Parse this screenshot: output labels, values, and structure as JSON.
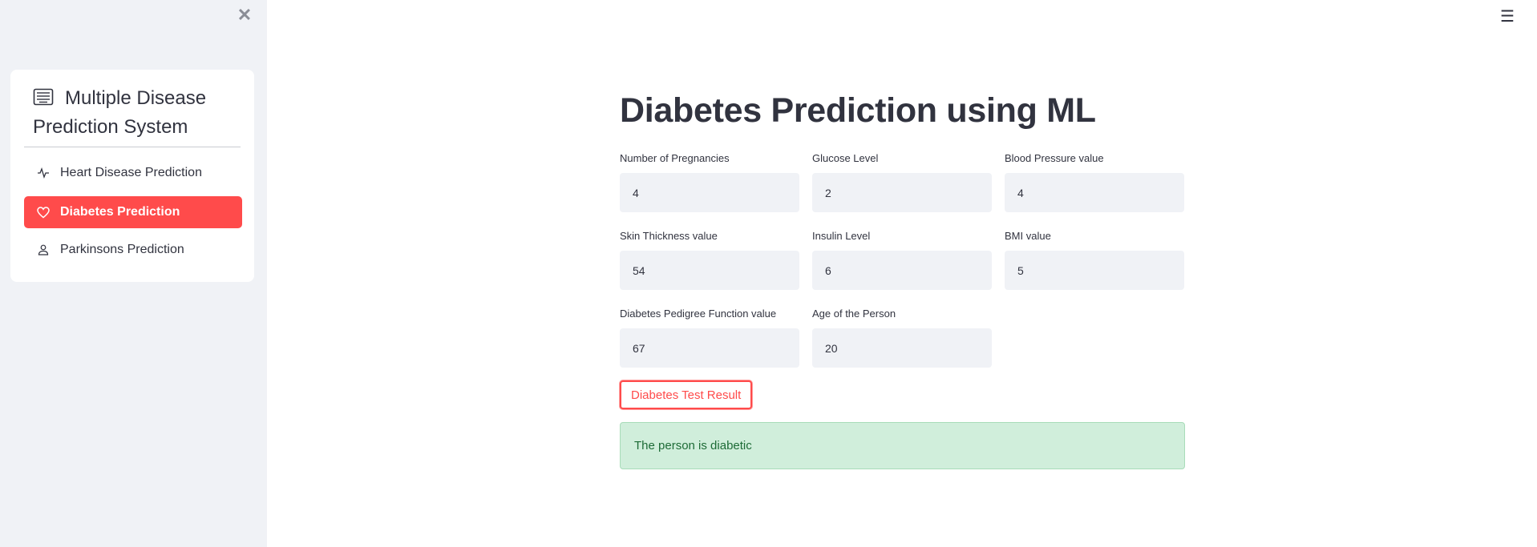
{
  "sidebar": {
    "close_icon": "close-icon",
    "menu_title": "Multiple Disease Prediction System",
    "menu_title_icon": "menu-list-icon",
    "items": [
      {
        "label": "Heart Disease Prediction",
        "icon": "activity-icon",
        "active": false
      },
      {
        "label": "Diabetes Prediction",
        "icon": "heart-icon",
        "active": true
      },
      {
        "label": "Parkinsons Prediction",
        "icon": "person-icon",
        "active": false
      }
    ]
  },
  "header": {
    "menu_icon": "hamburger-icon"
  },
  "main": {
    "title": "Diabetes Prediction using ML",
    "fields": [
      {
        "label": "Number of Pregnancies",
        "value": "4"
      },
      {
        "label": "Glucose Level",
        "value": "2"
      },
      {
        "label": "Blood Pressure value",
        "value": "4"
      },
      {
        "label": "Skin Thickness value",
        "value": "54"
      },
      {
        "label": "Insulin Level",
        "value": "6"
      },
      {
        "label": "BMI value",
        "value": "5"
      },
      {
        "label": "Diabetes Pedigree Function value",
        "value": "67"
      },
      {
        "label": "Age of the Person",
        "value": "20"
      }
    ],
    "button_label": "Diabetes Test Result",
    "result_message": "The person is diabetic"
  },
  "colors": {
    "accent": "#ff4b4b",
    "sidebar_bg": "#f0f2f6",
    "success_bg": "#d0eedb",
    "success_text": "#1d6b36"
  }
}
